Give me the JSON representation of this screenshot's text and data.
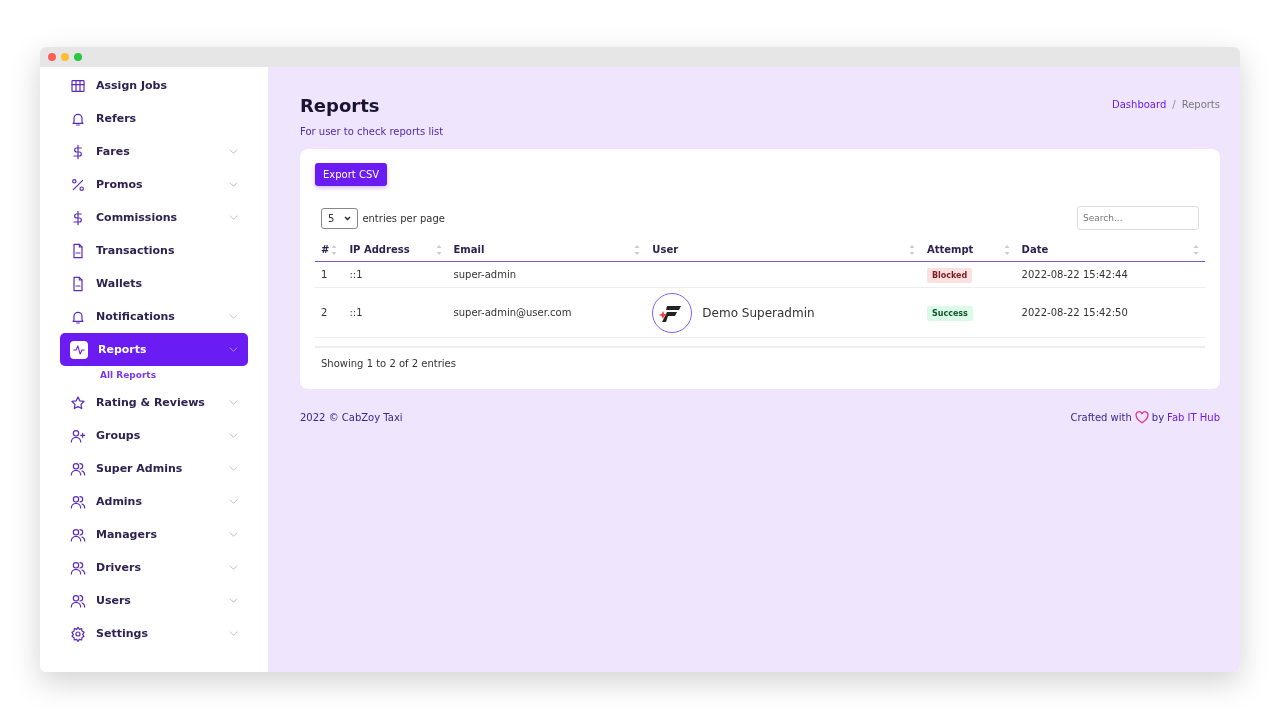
{
  "sidebar": {
    "items": [
      {
        "label": "Assign Jobs",
        "has_submenu": false,
        "selected": false
      },
      {
        "label": "Refers",
        "has_submenu": false,
        "selected": false
      },
      {
        "label": "Fares",
        "has_submenu": true,
        "selected": false
      },
      {
        "label": "Promos",
        "has_submenu": true,
        "selected": false
      },
      {
        "label": "Commissions",
        "has_submenu": true,
        "selected": false
      },
      {
        "label": "Transactions",
        "has_submenu": false,
        "selected": false
      },
      {
        "label": "Wallets",
        "has_submenu": false,
        "selected": false
      },
      {
        "label": "Notifications",
        "has_submenu": true,
        "selected": false
      },
      {
        "label": "Reports",
        "has_submenu": true,
        "selected": true,
        "children": [
          {
            "label": "All Reports"
          }
        ]
      },
      {
        "label": "Rating & Reviews",
        "has_submenu": true,
        "selected": false
      },
      {
        "label": "Groups",
        "has_submenu": true,
        "selected": false
      },
      {
        "label": "Super Admins",
        "has_submenu": true,
        "selected": false
      },
      {
        "label": "Admins",
        "has_submenu": true,
        "selected": false
      },
      {
        "label": "Managers",
        "has_submenu": true,
        "selected": false
      },
      {
        "label": "Drivers",
        "has_submenu": true,
        "selected": false
      },
      {
        "label": "Users",
        "has_submenu": true,
        "selected": false
      },
      {
        "label": "Settings",
        "has_submenu": true,
        "selected": false
      }
    ]
  },
  "page": {
    "title": "Reports",
    "subtitle": "For user to check reports list",
    "breadcrumb": [
      {
        "label": "Dashboard",
        "kind": "link"
      },
      {
        "label": "Reports",
        "kind": "current"
      }
    ],
    "separator": "/"
  },
  "card": {
    "export_button": "Export CSV",
    "page_size": "5",
    "page_size_label": "entries per page",
    "search": {
      "placeholder": "Search..."
    },
    "table": {
      "columns": [
        "#",
        "IP Address",
        "Email",
        "User",
        "Attempt",
        "Date"
      ],
      "rows": [
        {
          "cells": [
            "1",
            "::1",
            "super-admin",
            "",
            "Blocked",
            "2022-08-22 15:42:44"
          ],
          "has_avatar": false,
          "blocked": true
        },
        {
          "cells": [
            "2",
            "::1",
            "super-admin@user.com",
            "Demo Superadmin",
            "Success",
            "2022-08-22 15:42:50"
          ],
          "has_avatar": true,
          "blocked": false
        }
      ]
    },
    "info": "Showing 1 to 2 of 2 entries"
  },
  "footer": {
    "copyright": "2022 © CabZoy Taxi",
    "crafted": "Crafted with",
    "by": "by",
    "link": "Fab IT Hub"
  }
}
